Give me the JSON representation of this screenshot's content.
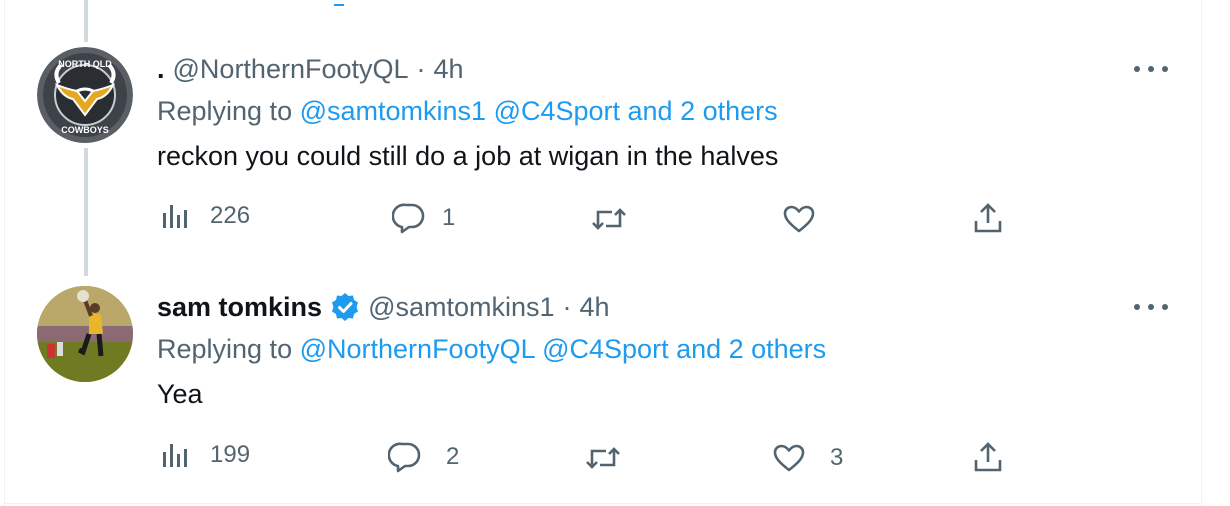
{
  "tweets": [
    {
      "display_name": ".",
      "handle": "@NorthernFootyQL",
      "separator": "·",
      "time": "4h",
      "replying_prefix": "Replying to",
      "replying_links": "@samtomkins1 @C4Sport and 2 others",
      "text": "reckon you could still do a job at wigan in the halves",
      "views": "226",
      "replies": "1",
      "retweets": "",
      "likes": "",
      "avatar_text_top": "NORTH QLD",
      "avatar_text_bottom": "COWBOYS",
      "avatar_icon": "cowboys-logo-avatar"
    },
    {
      "display_name": "sam tomkins",
      "handle": "@samtomkins1",
      "separator": "·",
      "time": "4h",
      "replying_prefix": "Replying to",
      "replying_links": "@NorthernFootyQL @C4Sport and 2 others",
      "text": "Yea",
      "views": "199",
      "replies": "2",
      "retweets": "",
      "likes": "3",
      "avatar_icon": "player-photo-avatar",
      "verified": true
    }
  ],
  "colors": {
    "link": "#1d9bf0",
    "secondary": "#536471",
    "primary": "#0f1419",
    "thread_line": "#cfd9de"
  },
  "icons": [
    "views-icon",
    "reply-icon",
    "retweet-icon",
    "like-icon",
    "share-icon",
    "more-icon",
    "verified-badge-icon"
  ]
}
